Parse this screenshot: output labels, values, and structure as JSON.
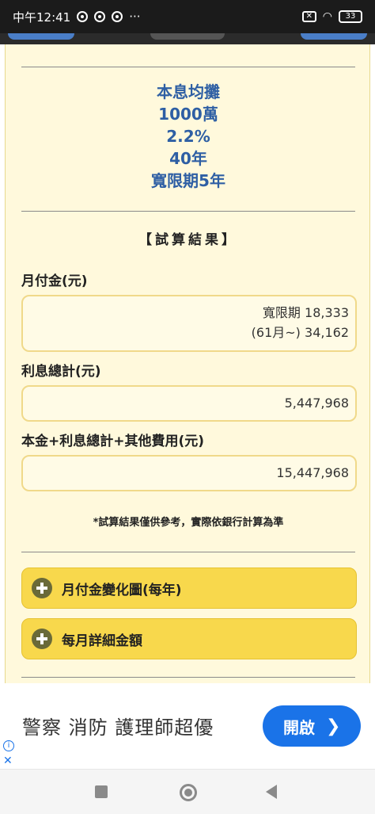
{
  "status_bar": {
    "time": "中午12:41",
    "more": "···",
    "battery": "33"
  },
  "summary": {
    "method": "本息均攤",
    "amount": "1000萬",
    "rate": "2.2%",
    "years": "40年",
    "grace": "寬限期5年"
  },
  "results": {
    "title": "【試算結果】",
    "monthly_label": "月付金(元)",
    "monthly_line1": "寬限期 18,333",
    "monthly_line2": "(61月~) 34,162",
    "interest_label": "利息總計(元)",
    "interest_value": "5,447,968",
    "total_label": "本金+利息總計+其他費用(元)",
    "total_value": "15,447,968",
    "note": "*試算結果僅供參考，實際依銀行計算為準"
  },
  "accordions": [
    {
      "label": "月付金變化圖(每年)"
    },
    {
      "label": "每月詳細金額"
    }
  ],
  "ad": {
    "text": "警察 消防 護理師超優",
    "button": "開啟"
  }
}
